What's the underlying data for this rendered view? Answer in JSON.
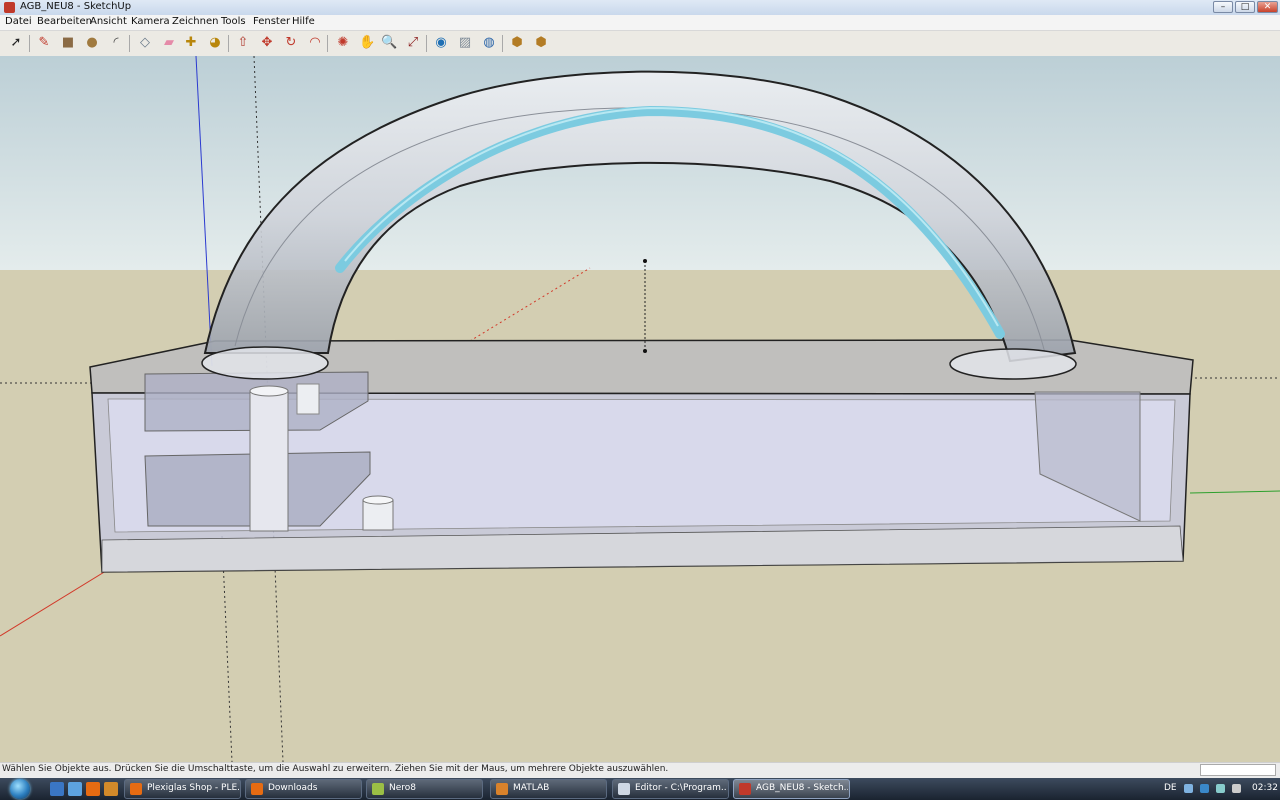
{
  "window": {
    "title": "AGB_NEU8 - SketchUp",
    "min_label": "–",
    "max_label": "□",
    "close_label": "✕"
  },
  "menu": [
    "Datei",
    "Bearbeiten",
    "Ansicht",
    "Kamera",
    "Zeichnen",
    "Tools",
    "Fenster",
    "Hilfe"
  ],
  "toolbar_tools": [
    {
      "name": "select-icon",
      "glyph": "➚",
      "color": "#222222"
    },
    {
      "name": "pencil-icon",
      "glyph": "✎",
      "color": "#c0392b"
    },
    {
      "name": "rectangle-icon",
      "glyph": "■",
      "color": "#8b6b45"
    },
    {
      "name": "circle-icon",
      "glyph": "●",
      "color": "#a07a3f"
    },
    {
      "name": "arc-icon",
      "glyph": "◜",
      "color": "#444444"
    },
    {
      "name": "make-component-icon",
      "glyph": "◇",
      "color": "#6a7a8a"
    },
    {
      "name": "eraser-icon",
      "glyph": "▰",
      "color": "#e58aa8"
    },
    {
      "name": "tape-measure-icon",
      "glyph": "✚",
      "color": "#b8860b"
    },
    {
      "name": "paint-bucket-icon",
      "glyph": "◕",
      "color": "#b8860b"
    },
    {
      "name": "push-pull-icon",
      "glyph": "⇧",
      "color": "#b03a2e"
    },
    {
      "name": "move-icon",
      "glyph": "✥",
      "color": "#c0392b"
    },
    {
      "name": "rotate-icon",
      "glyph": "↻",
      "color": "#c0392b"
    },
    {
      "name": "offset-icon",
      "glyph": "◠",
      "color": "#c0392b"
    },
    {
      "name": "orbit-icon",
      "glyph": "✺",
      "color": "#c0392b"
    },
    {
      "name": "pan-icon",
      "glyph": "✋",
      "color": "#555555"
    },
    {
      "name": "zoom-icon",
      "glyph": "🔍",
      "color": "#2e4a7a"
    },
    {
      "name": "zoom-extents-icon",
      "glyph": "⤢",
      "color": "#8b1c1c"
    },
    {
      "name": "add-location-icon",
      "glyph": "◉",
      "color": "#1e6fb4"
    },
    {
      "name": "toggle-terrain-icon",
      "glyph": "▨",
      "color": "#7d8a96"
    },
    {
      "name": "google-earth-icon",
      "glyph": "◍",
      "color": "#2a64a8"
    },
    {
      "name": "get-models-icon",
      "glyph": "⬢",
      "color": "#b37c25"
    },
    {
      "name": "share-model-icon",
      "glyph": "⬢",
      "color": "#b37c25"
    }
  ],
  "status": {
    "text": "Wählen Sie Objekte aus. Drücken Sie die Umschalttaste, um die Auswahl zu erweitern. Ziehen Sie mit der Maus, um mehrere Objekte auszuwählen."
  },
  "taskbar": {
    "tasks": [
      {
        "label": "Plexiglas Shop - PLE...",
        "icon_color": "#e66b12"
      },
      {
        "label": "Downloads",
        "icon_color": "#e66b12"
      },
      {
        "label": "Nero8",
        "icon_color": "#9bbf45"
      },
      {
        "label": "MATLAB",
        "icon_color": "#d9822b"
      },
      {
        "label": "Editor - C:\\Program...",
        "icon_color": "#cfd8e4"
      },
      {
        "label": "AGB_NEU8 - Sketch...",
        "icon_color": "#c0392b",
        "active": true
      }
    ],
    "language": "DE",
    "clock": "02:32"
  },
  "colors": {
    "sky": "#cfdde2",
    "ground": "#d3ceb2",
    "tube": "#d9dde3",
    "water_band": "#7ccbe0",
    "box_glass": "#c9cbe2",
    "axis_red": "#d23a2a",
    "axis_green": "#2da02d",
    "axis_blue": "#2b3ad0"
  }
}
